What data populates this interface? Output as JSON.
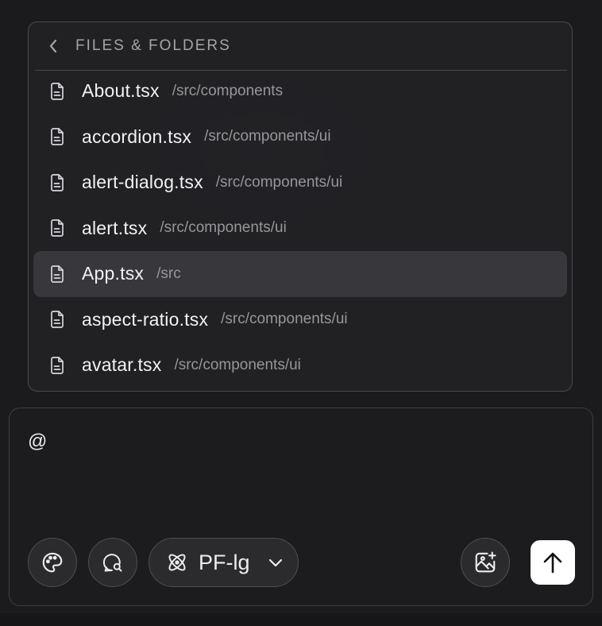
{
  "popup": {
    "title": "FILES & FOLDERS",
    "files": [
      {
        "name": "About.tsx",
        "path": "/src/components",
        "active": false
      },
      {
        "name": "accordion.tsx",
        "path": "/src/components/ui",
        "active": false
      },
      {
        "name": "alert-dialog.tsx",
        "path": "/src/components/ui",
        "active": false
      },
      {
        "name": "alert.tsx",
        "path": "/src/components/ui",
        "active": false
      },
      {
        "name": "App.tsx",
        "path": "/src",
        "active": true
      },
      {
        "name": "aspect-ratio.tsx",
        "path": "/src/components/ui",
        "active": false
      },
      {
        "name": "avatar.tsx",
        "path": "/src/components/ui",
        "active": false
      }
    ]
  },
  "composer": {
    "input_value": "@",
    "model_label": "PF-lg"
  },
  "icons": {
    "back": "chevron-left-icon",
    "file": "file-text-icon",
    "palette": "palette-icon",
    "chat": "message-search-icon",
    "model": "atom-icon",
    "dropdown": "chevron-down-icon",
    "image_add": "image-plus-icon",
    "send": "arrow-up-icon"
  },
  "colors": {
    "background": "#1b1b1d",
    "active_row": "#38383c",
    "send_button": "#ffffff"
  }
}
